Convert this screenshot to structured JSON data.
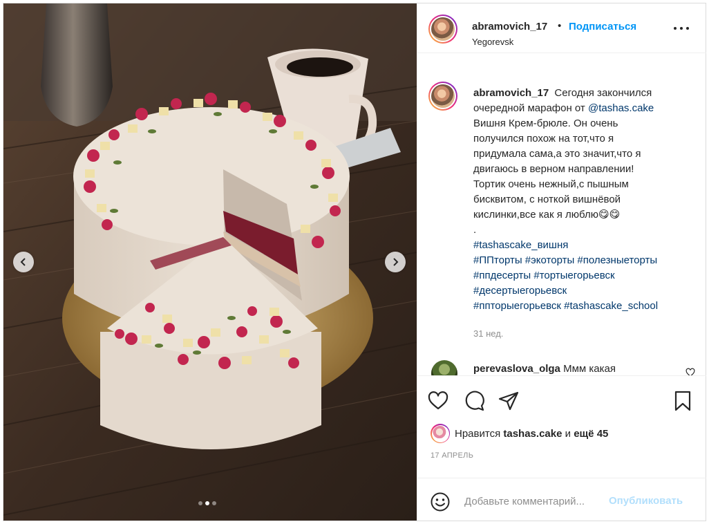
{
  "header": {
    "username": "abramovich_17",
    "separator": "•",
    "follow_label": "Подписаться",
    "location": "Yegorevsk"
  },
  "caption": {
    "username": "abramovich_17",
    "lines": [
      "Сегодня закончился",
      "очередной марафон от",
      "Вишня Крем-брюле. Он очень",
      "получился похож на тот,что я",
      "придумала сама,а это значит,что я",
      "двигаюсь в верном направлении!",
      "Тортик очень нежный,с пышным",
      "бисквитом, с ноткой вишнёвой",
      "кислинки,все как я люблю😋😋",
      "."
    ],
    "mention": "@tashas.cake",
    "hashtags_lines": [
      [
        "#tashascake_вишня"
      ],
      [
        "#ППторты",
        "#экоторты",
        "#полезныеторты"
      ],
      [
        "#ппдесерты",
        "#тортыегорьевск"
      ],
      [
        "#десертыегорьевск"
      ],
      [
        "#ппторыегорьевск",
        "#tashascake_school"
      ]
    ],
    "time_ago": "31 нед."
  },
  "comment": {
    "username": "perevaslova_olga",
    "text": "Ммм какая"
  },
  "actions": {
    "like_icon": "heart-icon",
    "comment_icon": "comment-icon",
    "share_icon": "paper-plane-icon",
    "save_icon": "bookmark-icon"
  },
  "likes": {
    "prefix": "Нравится",
    "user": "tashas.cake",
    "and": "и",
    "more": "ещё 45"
  },
  "date": "17 АПРЕЛЬ",
  "add_comment": {
    "placeholder": "Добавьте комментарий...",
    "publish_label": "Опубликовать"
  },
  "carousel": {
    "slide_count": 3,
    "active_index": 1
  },
  "colors": {
    "link_blue": "#0095f6",
    "hashtag_blue": "#00376b",
    "muted": "#8e8e8e",
    "publish_disabled": "#b2dffc"
  }
}
